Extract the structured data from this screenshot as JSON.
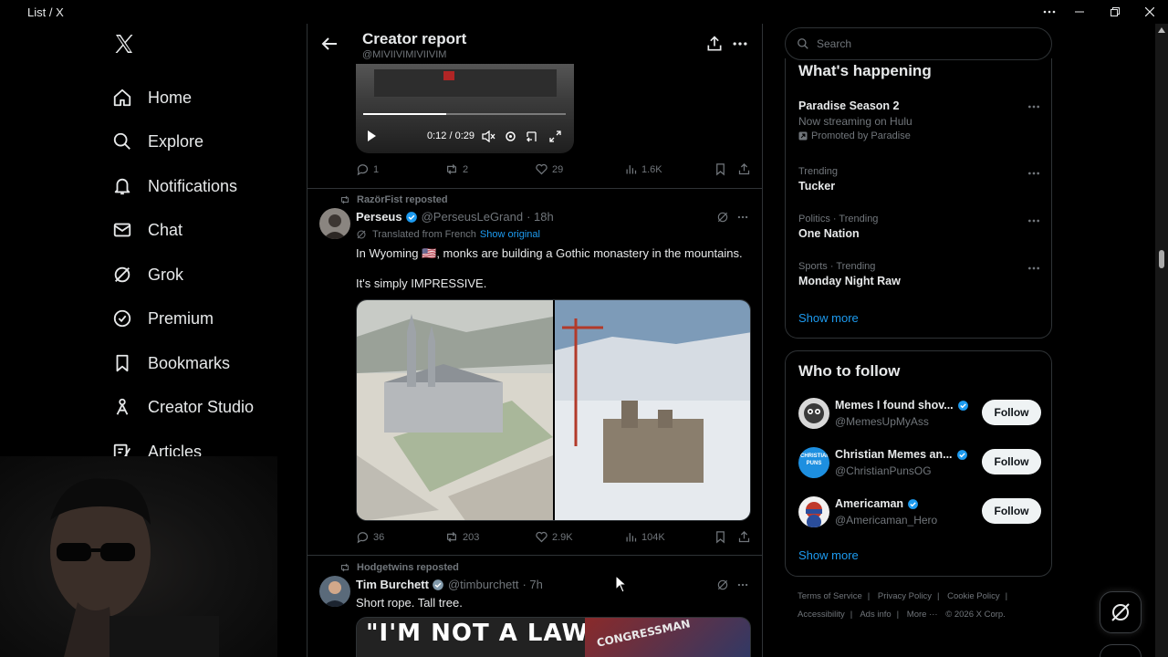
{
  "window": {
    "title": "List / X",
    "menu_icon": "ellipsis-icon"
  },
  "nav": {
    "items": [
      {
        "label": "Home",
        "icon": "home-icon"
      },
      {
        "label": "Explore",
        "icon": "search-icon"
      },
      {
        "label": "Notifications",
        "icon": "bell-icon"
      },
      {
        "label": "Chat",
        "icon": "mail-icon"
      },
      {
        "label": "Grok",
        "icon": "grok-icon"
      },
      {
        "label": "Premium",
        "icon": "premium-icon"
      },
      {
        "label": "Bookmarks",
        "icon": "bookmark-icon"
      },
      {
        "label": "Creator Studio",
        "icon": "creator-icon"
      },
      {
        "label": "Articles",
        "icon": "articles-icon"
      }
    ]
  },
  "header": {
    "title": "Creator report",
    "subtitle": "@MIVIIVIMIVIIVIM"
  },
  "video": {
    "time": "0:12 / 0:29",
    "progress": 0.41
  },
  "tweet0": {
    "replies": "1",
    "reposts": "2",
    "likes": "29",
    "views": "1.6K"
  },
  "tweet1": {
    "reposted_by": "RazörFist reposted",
    "name": "Perseus",
    "handle": "@PerseusLeGrand",
    "time": "· 18h",
    "translated": "Translated from French",
    "show_original": "Show original",
    "text_line1": "In Wyoming 🇺🇸, monks are building a Gothic monastery in the mountains.",
    "text_line2": "It's simply IMPRESSIVE.",
    "replies": "36",
    "reposts": "203",
    "likes": "2.9K",
    "views": "104K"
  },
  "tweet2": {
    "reposted_by": "Hodgetwins reposted",
    "name": "Tim Burchett",
    "handle": "@timburchett",
    "time": "· 7h",
    "text": "Short rope. Tall tree.",
    "image_text": "\"I'M NOT A LAWYER",
    "image_text2": "CONGRESSMAN"
  },
  "search": {
    "placeholder": "Search"
  },
  "whats_happening": {
    "title": "What's happening",
    "trends": [
      {
        "meta": "",
        "title": "Paradise Season 2",
        "sub": "Now streaming on Hulu",
        "promo": "Promoted by Paradise"
      },
      {
        "meta": "Trending",
        "title": "Tucker"
      },
      {
        "meta": "Politics · Trending",
        "title": "One Nation"
      },
      {
        "meta": "Sports · Trending",
        "title": "Monday Night Raw"
      }
    ],
    "show_more": "Show more"
  },
  "who_to_follow": {
    "title": "Who to follow",
    "accounts": [
      {
        "name": "Memes I found shov...",
        "handle": "@MemesUpMyAss"
      },
      {
        "name": "Christian Memes an...",
        "handle": "@ChristianPunsOG",
        "avatar_text": "CHRISTIAN PUNS"
      },
      {
        "name": "Americaman",
        "handle": "@Americaman_Hero"
      }
    ],
    "follow_label": "Follow",
    "show_more": "Show more"
  },
  "footer": {
    "links": [
      "Terms of Service",
      "|",
      "Privacy Policy",
      "|",
      "Cookie Policy",
      "|",
      "Accessibility",
      "|",
      "Ads info",
      "|",
      "More ···",
      "© 2026 X Corp."
    ]
  },
  "colors": {
    "accent": "#1d9bf0",
    "background": "#000000",
    "border": "#2f3336",
    "muted": "#71767b"
  }
}
